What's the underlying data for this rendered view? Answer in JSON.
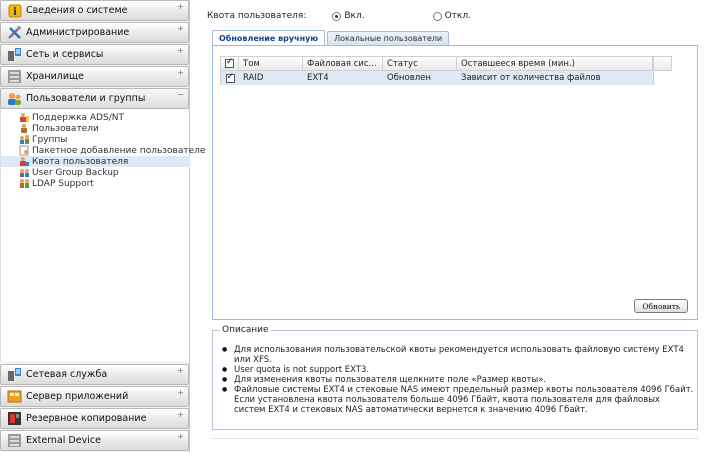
{
  "sidebar": {
    "top_sections": [
      {
        "label": "Сведения о системе",
        "icon": "info-icon",
        "toggle": "+"
      },
      {
        "label": "Администрирование",
        "icon": "tools-icon",
        "toggle": "+"
      },
      {
        "label": "Сеть и сервисы",
        "icon": "network-icon",
        "toggle": "+"
      },
      {
        "label": "Хранилище",
        "icon": "storage-icon",
        "toggle": "+"
      },
      {
        "label": "Пользователи и группы",
        "icon": "users-icon",
        "toggle": "−"
      }
    ],
    "tree": [
      {
        "label": "Поддержка ADS/NT",
        "icon": "ads-icon"
      },
      {
        "label": "Пользователи",
        "icon": "user-icon"
      },
      {
        "label": "Группы",
        "icon": "group-icon"
      },
      {
        "label": "Пакетное добавление пользователе",
        "icon": "batch-icon"
      },
      {
        "label": "Квота пользователя",
        "icon": "quota-icon",
        "selected": true
      },
      {
        "label": "User Group Backup",
        "icon": "backup-user-icon"
      },
      {
        "label": "LDAP Support",
        "icon": "ldap-icon"
      }
    ],
    "bottom_sections": [
      {
        "label": "Сетевая служба",
        "icon": "network-service-icon",
        "toggle": "+"
      },
      {
        "label": "Сервер приложений",
        "icon": "app-server-icon",
        "toggle": "+"
      },
      {
        "label": "Резервное копирование",
        "icon": "backup-icon",
        "toggle": "+"
      },
      {
        "label": "External Device",
        "icon": "external-device-icon",
        "toggle": "+"
      }
    ]
  },
  "quota": {
    "label": "Квота пользователя:",
    "on_label": "Вкл.",
    "off_label": "Откл.",
    "selected": "on"
  },
  "tabs": [
    {
      "label": "Обновление вручную",
      "active": true
    },
    {
      "label": "Локальные пользователи",
      "active": false
    }
  ],
  "grid": {
    "columns": [
      "Том",
      "Файловая сис...",
      "Статус",
      "Оставшееся время (мин.)"
    ],
    "header_checked": true,
    "rows": [
      {
        "checked": true,
        "volume": "RAID",
        "fs": "EXT4",
        "status": "Обновлен",
        "remaining": "Зависит от количества файлов"
      }
    ]
  },
  "update_button": "Обновить",
  "description": {
    "legend": "Описание",
    "items": [
      "Для использования пользовательской квоты рекомендуется использовать файловую систему EXT4 или XFS.",
      "User quota is not support EXT3.",
      "Для изменения квоты пользователя щелкните поле «Размер квоты».",
      "Файловые системы EXT4 и стековые NAS имеют предельный размер квоты пользователя 4096 Гбайт. Если установлена квота пользователя больше 4096 Гбайт, квота пользователя для файловых систем EXT4 и стековых NAS автоматически вернется к значению 4096 Гбайт."
    ]
  },
  "colors": {
    "selection": "#dfe8f6",
    "panel_border": "#99bbe8",
    "active_tab_text": "#15428b"
  }
}
